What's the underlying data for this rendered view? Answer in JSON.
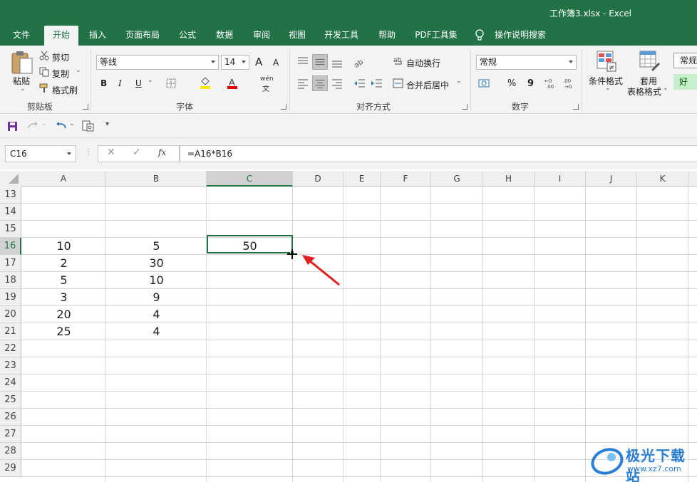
{
  "window": {
    "title": "工作簿3.xlsx  -  Excel"
  },
  "tabs": [
    {
      "label": "文件"
    },
    {
      "label": "开始"
    },
    {
      "label": "插入"
    },
    {
      "label": "页面布局"
    },
    {
      "label": "公式"
    },
    {
      "label": "数据"
    },
    {
      "label": "审阅"
    },
    {
      "label": "视图"
    },
    {
      "label": "开发工具"
    },
    {
      "label": "帮助"
    },
    {
      "label": "PDF工具集"
    },
    {
      "label": "操作说明搜索"
    }
  ],
  "ribbon": {
    "clipboard": {
      "paste": "粘贴",
      "cut": "剪切",
      "copy": "复制",
      "format_painter": "格式刷",
      "label": "剪贴板"
    },
    "font": {
      "name": "等线",
      "size": "14",
      "label": "字体",
      "bold": "B",
      "italic": "I",
      "underline": "U",
      "grow": "A",
      "shrink": "A",
      "phonetic_top": "wén",
      "phonetic_bottom": "文"
    },
    "alignment": {
      "wrap": "自动换行",
      "merge": "合并后居中",
      "label": "对齐方式"
    },
    "number": {
      "format": "常规",
      "label": "数字",
      "percent": "%",
      "comma": "9"
    },
    "styles": {
      "conditional": "条件格式",
      "table_line1": "套用",
      "table_line2": "表格格式",
      "style_normal": "常规",
      "style_good": "好"
    }
  },
  "formula_bar": {
    "name_box": "C16",
    "formula": "=A16*B16",
    "fx": "fx"
  },
  "sheet": {
    "columns": [
      "A",
      "B",
      "C",
      "D",
      "E",
      "F",
      "G",
      "H",
      "I",
      "J",
      "K"
    ],
    "rows": [
      "13",
      "14",
      "15",
      "16",
      "17",
      "18",
      "19",
      "20",
      "21",
      "22",
      "23",
      "24",
      "25",
      "26",
      "27",
      "28",
      "29"
    ],
    "colA": [
      "",
      "",
      "",
      "10",
      "2",
      "5",
      "3",
      "20",
      "25"
    ],
    "colB": [
      "",
      "",
      "",
      "5",
      "30",
      "10",
      "9",
      "4",
      "4"
    ],
    "colC": [
      "",
      "",
      "",
      "50"
    ],
    "selected_cell": "C16",
    "accent_color": "#217346"
  },
  "watermark": {
    "text": "极光下载站",
    "url": "www.xz7.com"
  }
}
